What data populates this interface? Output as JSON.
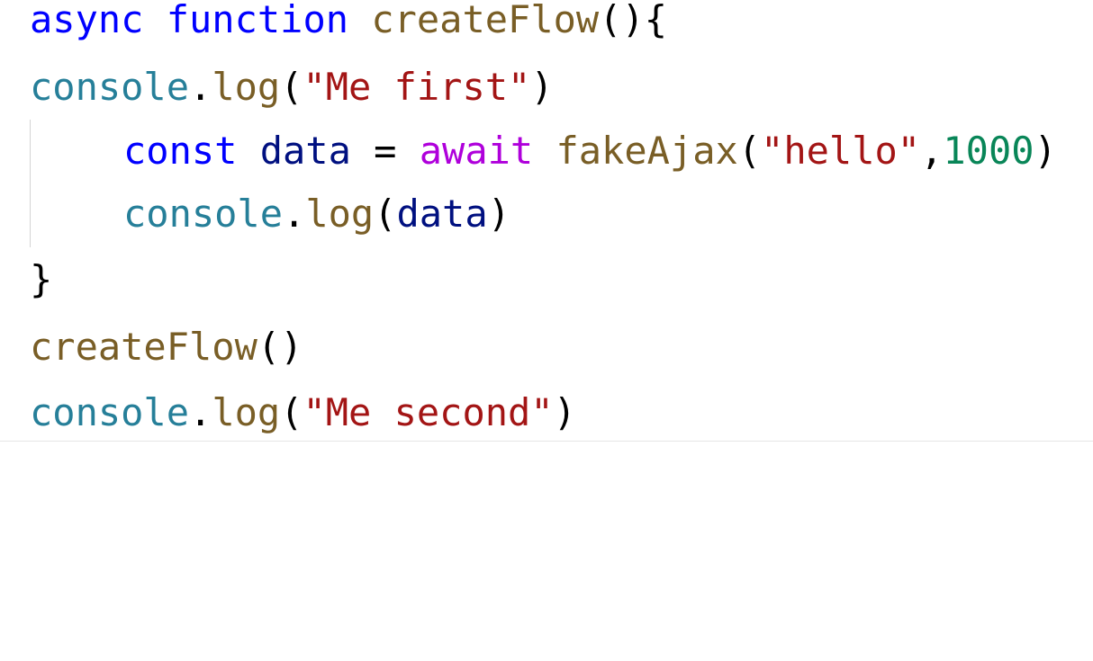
{
  "code": {
    "line1": {
      "async": "async",
      "space1": " ",
      "function": "function",
      "space2": " ",
      "name": "createFlow",
      "params": "()",
      "brace": "{"
    },
    "line2": {
      "obj": "console",
      "dot": ".",
      "method": "log",
      "open": "(",
      "arg": "\"Me first\"",
      "close": ")"
    },
    "line3": {
      "const": "const",
      "space1": " ",
      "var": "data",
      "eq": " = ",
      "await": "await",
      "space2": " ",
      "call": "fakeAjax",
      "open": "(",
      "arg1": "\"hello\"",
      "comma": ",",
      "arg2": "1000",
      "close": ")"
    },
    "line4": {
      "obj": "console",
      "dot": ".",
      "method": "log",
      "open": "(",
      "arg": "data",
      "close": ")"
    },
    "line5": {
      "brace": "}"
    },
    "line6": {
      "call": "createFlow",
      "parens": "()"
    },
    "line7": {
      "obj": "console",
      "dot": ".",
      "method": "log",
      "open": "(",
      "arg": "\"Me second\"",
      "close": ")"
    }
  }
}
